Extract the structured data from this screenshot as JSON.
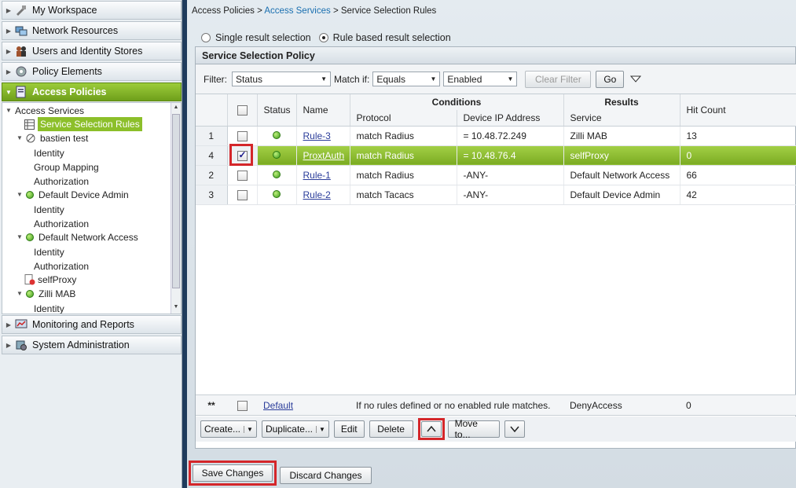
{
  "nav": {
    "drawers": [
      {
        "label": "My Workspace",
        "icon": "workspace-icon"
      },
      {
        "label": "Network Resources",
        "icon": "network-icon"
      },
      {
        "label": "Users and Identity Stores",
        "icon": "users-icon"
      },
      {
        "label": "Policy Elements",
        "icon": "policy-elements-icon"
      },
      {
        "label": "Access Policies",
        "icon": "access-policies-icon"
      },
      {
        "label": "Monitoring and Reports",
        "icon": "monitoring-icon"
      },
      {
        "label": "System Administration",
        "icon": "system-admin-icon"
      }
    ],
    "tree": {
      "access_services": "Access Services",
      "service_selection_rules": "Service Selection Rules",
      "bastien_test": "bastien test",
      "identity": "Identity",
      "group_mapping": "Group Mapping",
      "authorization": "Authorization",
      "default_device_admin": "Default Device Admin",
      "default_network_access": "Default Network Access",
      "self_proxy": "selfProxy",
      "zilli_mab": "Zilli MAB"
    }
  },
  "breadcrumb": {
    "root": "Access Policies",
    "sep": ">",
    "link": "Access Services",
    "current": "Service Selection Rules"
  },
  "mode": {
    "single": "Single result selection",
    "rule_based": "Rule based result selection",
    "selected": "rule_based"
  },
  "panel": {
    "title": "Service Selection Policy"
  },
  "filter": {
    "label": "Filter:",
    "field": "Status",
    "match_label": "Match if:",
    "operator": "Equals",
    "value": "Enabled",
    "clear": "Clear Filter",
    "go": "Go"
  },
  "table": {
    "headers": {
      "status": "Status",
      "name": "Name",
      "conditions": "Conditions",
      "protocol": "Protocol",
      "device_ip": "Device IP Address",
      "results": "Results",
      "service": "Service",
      "hit_count": "Hit Count"
    },
    "rows": [
      {
        "num": "1",
        "checked": false,
        "name": "Rule-3",
        "protocol": "match Radius",
        "device_ip": "= 10.48.72.249",
        "service": "Zilli MAB",
        "hits": "13"
      },
      {
        "num": "4",
        "checked": true,
        "name": "ProxtAuth",
        "protocol": "match Radius",
        "device_ip": "= 10.48.76.4",
        "service": "selfProxy",
        "hits": "0"
      },
      {
        "num": "2",
        "checked": false,
        "name": "Rule-1",
        "protocol": "match Radius",
        "device_ip": "-ANY-",
        "service": "Default Network Access",
        "hits": "66"
      },
      {
        "num": "3",
        "checked": false,
        "name": "Rule-2",
        "protocol": "match Tacacs",
        "device_ip": "-ANY-",
        "service": "Default Device Admin",
        "hits": "42"
      }
    ],
    "default_row": {
      "num": "**",
      "name": "Default",
      "condition": "If no rules defined or no enabled rule matches.",
      "service": "DenyAccess",
      "hits": "0"
    }
  },
  "toolbar": {
    "create": "Create...",
    "duplicate": "Duplicate...",
    "edit": "Edit",
    "delete": "Delete",
    "move_to": "Move to..."
  },
  "footer": {
    "save": "Save Changes",
    "discard": "Discard Changes"
  },
  "colors": {
    "accent_green": "#7bab22",
    "highlight_red": "#d4262a",
    "splitter": "#1f3b5c"
  }
}
